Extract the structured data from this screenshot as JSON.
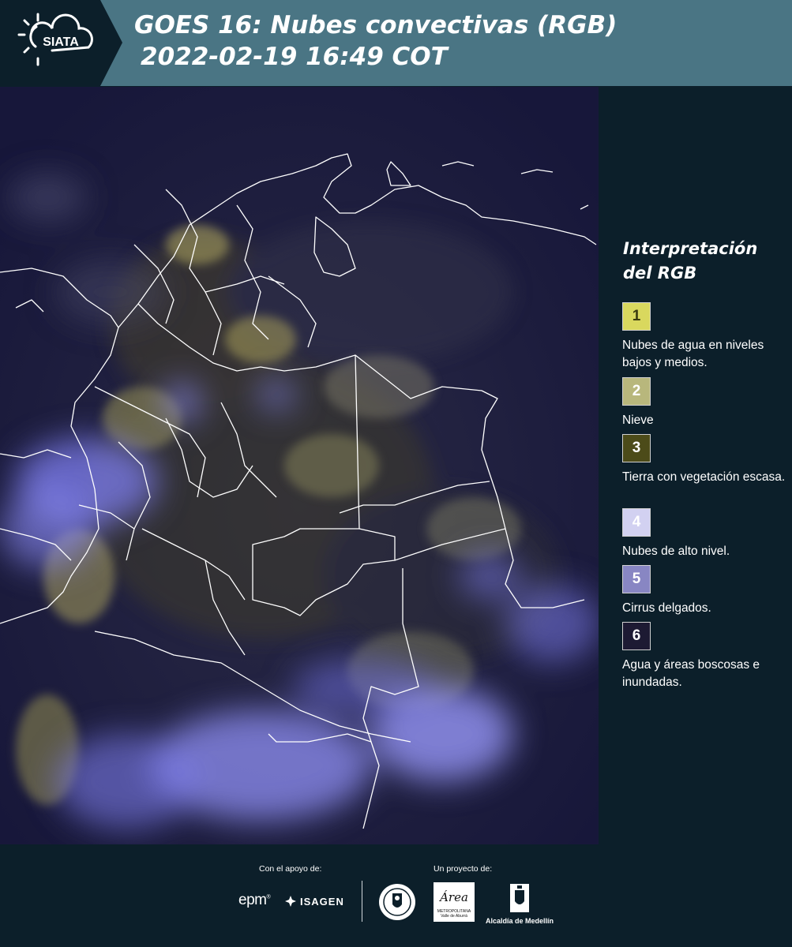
{
  "header": {
    "logo_text": "SIATA",
    "title_line1": "GOES 16: Nubes convectivas (RGB)",
    "title_line2": "2022-02-19 16:49 COT"
  },
  "legend": {
    "title": "Interpretación del RGB",
    "items": [
      {
        "number": "1",
        "label": "Nubes de agua en niveles bajos y medios.",
        "color": "#d9d85e",
        "text_color": "#3a3a10"
      },
      {
        "number": "2",
        "label": "Nieve",
        "color": "#b8b77c",
        "text_color": "#ffffff"
      },
      {
        "number": "3",
        "label": "Tierra con vegetación escasa.",
        "color": "#4c4b19",
        "text_color": "#ffffff"
      },
      {
        "number": "4",
        "label": "Nubes de alto nivel.",
        "color": "#d2d1f1",
        "text_color": "#ffffff"
      },
      {
        "number": "5",
        "label": "Cirrus delgados.",
        "color": "#8886c3",
        "text_color": "#ffffff"
      },
      {
        "number": "6",
        "label": "Agua y áreas boscosas e inundadas.",
        "color": "#1d1a33",
        "text_color": "#ffffff"
      }
    ]
  },
  "footer": {
    "support_label": "Con el apoyo de:",
    "project_label": "Un proyecto de:",
    "epm_text": "epm",
    "isagen_text": "ISAGEN",
    "area_text": "Área",
    "area_sub": "METROPOLITANA Valle de Aburrá",
    "alcaldia_text": "Alcaldía de Medellín"
  },
  "colors": {
    "header_bg": "#4a7584",
    "panel_bg": "#0c1f2a",
    "map_dark": "#1c1c45",
    "high_cloud": "#8f8ef0",
    "low_cloud": "#c8c26a"
  }
}
